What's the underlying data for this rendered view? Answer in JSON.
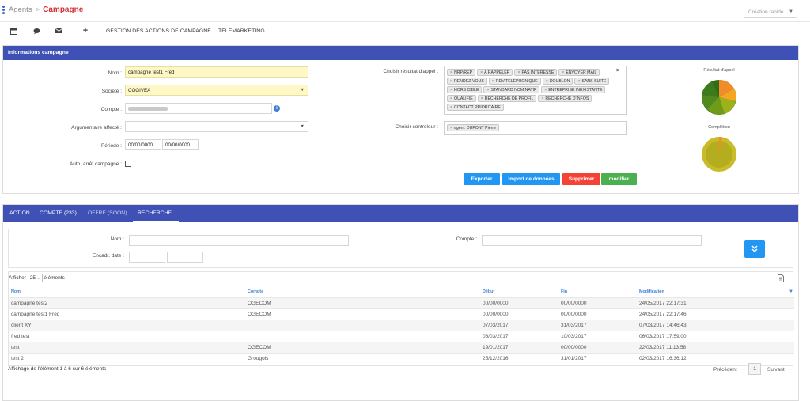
{
  "breadcrumb": {
    "parent": "Agents",
    "separator": ">",
    "current": "Campagne"
  },
  "quick_create": {
    "label": "Création rapide"
  },
  "toolbar": {
    "icons": [
      "calendar-icon",
      "chat-icon",
      "mail-icon",
      "plus-icon"
    ],
    "actions_label": "GESTION DES ACTIONS DE CAMPAGNE",
    "telemarketing_label": "TÉLÉMARKETING"
  },
  "info_panel": {
    "title": "Informations campagne",
    "nom_label": "Nom :",
    "nom_value": "campagne test1 Fred",
    "societe_label": "Société :",
    "societe_value": "COGIVEA",
    "compte_label": "Compte :",
    "argumentaire_label": "Argumentaire affecté :",
    "periode_label": "Période :",
    "periode_start": "00/00/0000",
    "periode_end": "00/00/0000",
    "auto_arret_label": "Auto. arrêt campagne :",
    "resultat_label": "Choisir résultat d'appel :",
    "resultat_tags": [
      "NRP/REP",
      "A RAPPELER",
      "PAS INTERESSE",
      "ENVOYER MAIL",
      "RENDEZ-VOUS",
      "RDV TELEPHONIQUE",
      "DOUBLON",
      "SANS SUITE",
      "HORS CIBLE",
      "STANDARD NOMINATIF",
      "ENTREPRISE INEXISTANTE",
      "QUALIFIE",
      "RECHERCHE DE PROFIL",
      "RECHERCHE D'INFOS",
      "CONTACT PRIORITAIRE"
    ],
    "controleur_label": "Choisir controleur :",
    "controleur_tags": [
      "agent: DUPONT Pierre"
    ],
    "buttons": {
      "export": "Exporter",
      "import": "Import de données",
      "delete": "Supprimer",
      "modify": "modifier"
    },
    "chart1_title": "Résultat d'appel",
    "chart2_title": "Complétion"
  },
  "tabs": [
    {
      "label": "ACTION",
      "active": false
    },
    {
      "label": "COMPTE (233)",
      "active": false
    },
    {
      "label": "OFFRE (SOON)",
      "active": false
    },
    {
      "label": "RECHERCHE",
      "active": true
    }
  ],
  "search": {
    "nom_label": "Nom :",
    "compte_label": "Compte :",
    "encadr_label": "Encadr. date :"
  },
  "table": {
    "show_prefix": "Afficher",
    "page_size": "25",
    "show_suffix": "éléments",
    "columns": [
      "Nom",
      "Compte",
      "Début",
      "Fin",
      "Modification"
    ],
    "rows": [
      [
        "campagne test2",
        "OGECOM",
        "00/00/0000",
        "00/00/0000",
        "24/05/2017 22:17:31"
      ],
      [
        "campagne test1 Fred",
        "OGECOM",
        "00/00/0000",
        "00/00/0000",
        "24/05/2017 22:17:46"
      ],
      [
        "client XY",
        "",
        "07/03/2017",
        "31/03/2017",
        "07/03/2017 14:46:43"
      ],
      [
        "fred test",
        "",
        "06/03/2017",
        "10/03/2017",
        "06/03/2017 17:59:00"
      ],
      [
        "test",
        "OGECOM",
        "19/01/2017",
        "00/00/0000",
        "22/03/2017 11:13:58"
      ],
      [
        "test 2",
        "Grougois",
        "25/12/2016",
        "31/01/2017",
        "02/03/2017 16:36:12"
      ]
    ],
    "info": "Affichage de l'élément 1 à 6 sur 6 éléments",
    "prev": "Précédent",
    "page": "1",
    "next": "Suivant"
  },
  "colors": {
    "primary": "#3f51b5",
    "accent_blue": "#2196f3",
    "danger": "#f44336",
    "success": "#4caf50",
    "title_red": "#d13438"
  }
}
